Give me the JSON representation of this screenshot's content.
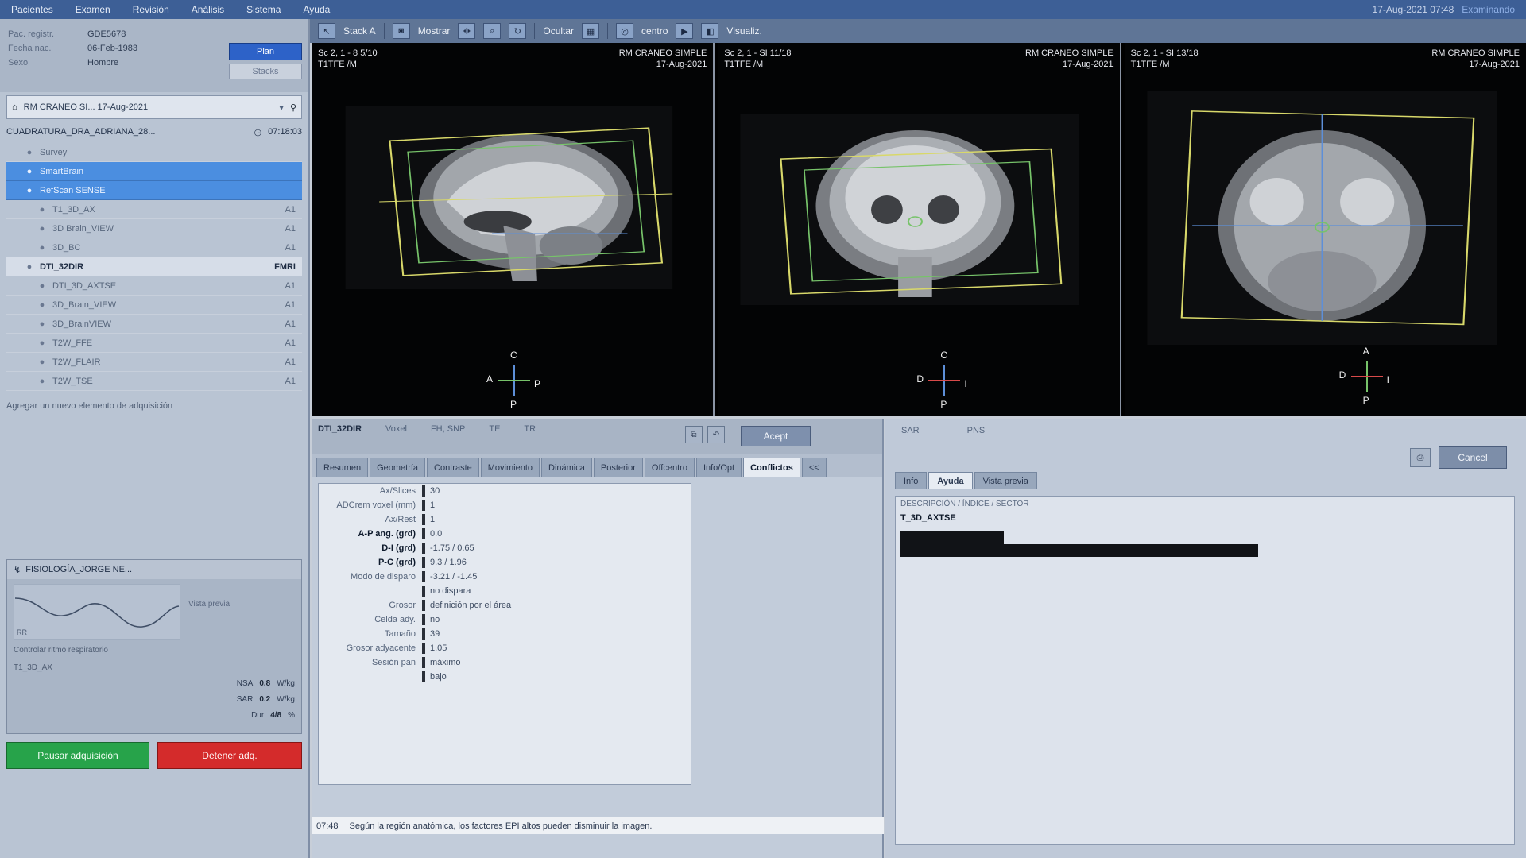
{
  "menu": {
    "items": [
      "Pacientes",
      "Examen",
      "Revisión",
      "Análisis",
      "Sistema",
      "Ayuda"
    ],
    "datetime": "17-Aug-2021 07:48",
    "user": "Examinando"
  },
  "toolbar": {
    "stack_label": "Stack A",
    "mostrar_label": "Mostrar",
    "ocultar_label": "Ocultar",
    "centro_label": "centro",
    "visualiz_label": "Visualiz."
  },
  "patient": {
    "id_label": "Pac. registr.",
    "id_value": "GDE5678",
    "dob_label": "Fecha nac.",
    "dob_value": "06-Feb-1983",
    "sex_label": "Sexo",
    "sex_value": "Hombre",
    "plan_button": "Plan",
    "stack_button": "Stacks"
  },
  "exam": {
    "selector_title": "RM CRANEO SI... 17-Aug-2021",
    "header": "CUADRATURA_DRA_ADRIANA_28...",
    "time": "07:18:03"
  },
  "scans": [
    {
      "name": "Survey",
      "tag": "",
      "style": "ind"
    },
    {
      "name": "SmartBrain",
      "tag": "",
      "style": "sel ind"
    },
    {
      "name": "RefScan SENSE",
      "tag": "",
      "style": "sel ind"
    },
    {
      "name": "T1_3D_AX",
      "tag": "A1",
      "style": "ind2"
    },
    {
      "name": "3D Brain_VIEW",
      "tag": "A1",
      "style": "ind2"
    },
    {
      "name": "3D_BC",
      "tag": "A1",
      "style": "ind2"
    },
    {
      "name": "DTI_32DIR",
      "tag": "FMRI",
      "style": "cur ind"
    },
    {
      "name": "DTI_3D_AXTSE",
      "tag": "A1",
      "style": "ind2"
    },
    {
      "name": "3D_Brain_VIEW",
      "tag": "A1",
      "style": "ind2"
    },
    {
      "name": "3D_BrainVIEW",
      "tag": "A1",
      "style": "ind2"
    },
    {
      "name": "T2W_FFE",
      "tag": "A1",
      "style": "ind2"
    },
    {
      "name": "T2W_FLAIR",
      "tag": "A1",
      "style": "ind2"
    },
    {
      "name": "T2W_TSE",
      "tag": "A1",
      "style": "ind2"
    }
  ],
  "add_element": "Agregar un nuevo elemento de adquisición",
  "monitor": {
    "title": "FISIOLOGÍA_JORGE NE...",
    "link": "Vista previa",
    "line1": "Controlar ritmo respiratorio",
    "line2": "T1_3D_AX",
    "wave_label": "RR",
    "nsa_label": "NSA",
    "nsa_value": "0.8",
    "nsa_unit": "W/kg",
    "sar_label": "SAR",
    "sar_value": "0.2",
    "sar_unit": "W/kg",
    "dur_label": "Dur",
    "dur_value": "4/8",
    "dur_unit": "%"
  },
  "buttons": {
    "go": "Pausar adquisición",
    "stop": "Detener adq."
  },
  "viewports": [
    {
      "tl": "Sc 2, 1 - 8 5/10\nT1TFE /M",
      "tr": "RM CRANEO SIMPLE\n17-Aug-2021",
      "orient": {
        "top": "C",
        "left": "A",
        "right": "P",
        "bottom": "P"
      }
    },
    {
      "tl": "Sc 2, 1 - SI 11/18\nT1TFE /M",
      "tr": "RM CRANEO SIMPLE\n17-Aug-2021",
      "orient": {
        "top": "C",
        "left": "D",
        "right": "I",
        "bottom": "P"
      }
    },
    {
      "tl": "Sc 2, 1 - SI 13/18\nT1TFE /M",
      "tr": "RM CRANEO SIMPLE\n17-Aug-2021",
      "orient": {
        "top": "A",
        "left": "D",
        "right": "I",
        "bottom": "P"
      }
    }
  ],
  "protocol": {
    "name": "DTI_32DIR",
    "cols": [
      "Voxel",
      "FH, SNP",
      "TE",
      "TR"
    ],
    "accept": "Acept",
    "tabs": [
      "Resumen",
      "Geometría",
      "Contraste",
      "Movimiento",
      "Dinámica",
      "Posterior",
      "Offcentro",
      "Info/Opt",
      "Conflictos"
    ],
    "active_tab": "Conflictos",
    "collapse": "<<"
  },
  "params": [
    {
      "k": "Ax/Slices",
      "v": "30",
      "hl": false
    },
    {
      "k": "ADCrem voxel (mm)",
      "v": "1",
      "hl": false
    },
    {
      "k": "Ax/Rest",
      "v": "1",
      "hl": false
    },
    {
      "k": "A-P ang. (grd)",
      "v": "0.0",
      "hl": true
    },
    {
      "k": "D-I (grd)",
      "v": "-1.75 / 0.65",
      "hl": true
    },
    {
      "k": "P-C (grd)",
      "v": "9.3 / 1.96",
      "hl": true
    },
    {
      "k": "Modo de disparo",
      "v": "-3.21 / -1.45",
      "hl": false
    },
    {
      "k": "",
      "v": "no dispara",
      "hl": false
    },
    {
      "k": "Grosor",
      "v": "definición por el área",
      "hl": false
    },
    {
      "k": "Celda ady.",
      "v": "no",
      "hl": false
    },
    {
      "k": "Tamaño",
      "v": "39",
      "hl": false
    },
    {
      "k": "Grosor adyacente",
      "v": "1.05",
      "hl": false
    },
    {
      "k": "Sesión pan",
      "v": "máximo",
      "hl": false
    },
    {
      "k": "",
      "v": "bajo",
      "hl": false
    }
  ],
  "status": {
    "time": "07:48",
    "message": "Según la región anatómica, los factores EPI altos pueden disminuir la imagen."
  },
  "info": {
    "sar_label": "SAR",
    "pns_label": "PNS",
    "tabs": [
      "Info",
      "Ayuda",
      "Vista previa"
    ],
    "active_tab": "Ayuda",
    "cancel": "Cancel",
    "sub": "DESCRIPCIÓN / ÍNDICE / SECTOR",
    "line": "T_3D_AXTSE"
  }
}
